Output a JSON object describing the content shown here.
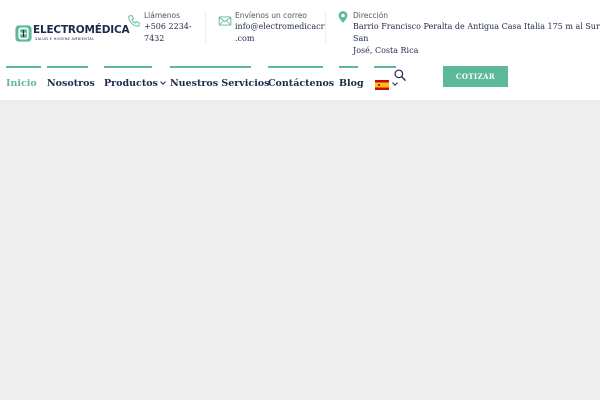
{
  "brand": {
    "name": "ELECTROMÉDICA",
    "tagline": "SALUD E HIGIENE AMBIENTAL",
    "accent": "#5cb99a",
    "navy": "#1d2a4a"
  },
  "contacts": {
    "phone": {
      "label": "Llámenos",
      "line1": "+506 2234-",
      "line2": "7432",
      "icon": "phone-icon"
    },
    "email": {
      "label": "Envíenos un correo",
      "line1": "info@electromedicacr",
      "line2": ".com",
      "icon": "envelope-icon"
    },
    "address": {
      "label": "Dirección",
      "line1": "Barrio Francisco Peralta de Antigua Casa Italia 175 m al Sur San",
      "line2": "José, Costa Rica",
      "icon": "map-pin-icon"
    }
  },
  "nav": {
    "items": [
      {
        "label": "Inicio",
        "active": true
      },
      {
        "label": "Nosotros"
      },
      {
        "label": "Productos",
        "has_dropdown": true
      },
      {
        "label": "Nuestros Servicios"
      },
      {
        "label": "Contáctenos"
      },
      {
        "label": "Blog"
      }
    ],
    "language_icon": "spain-flag-icon",
    "search_icon": "search-icon",
    "cta_label": "COTIZAR"
  }
}
